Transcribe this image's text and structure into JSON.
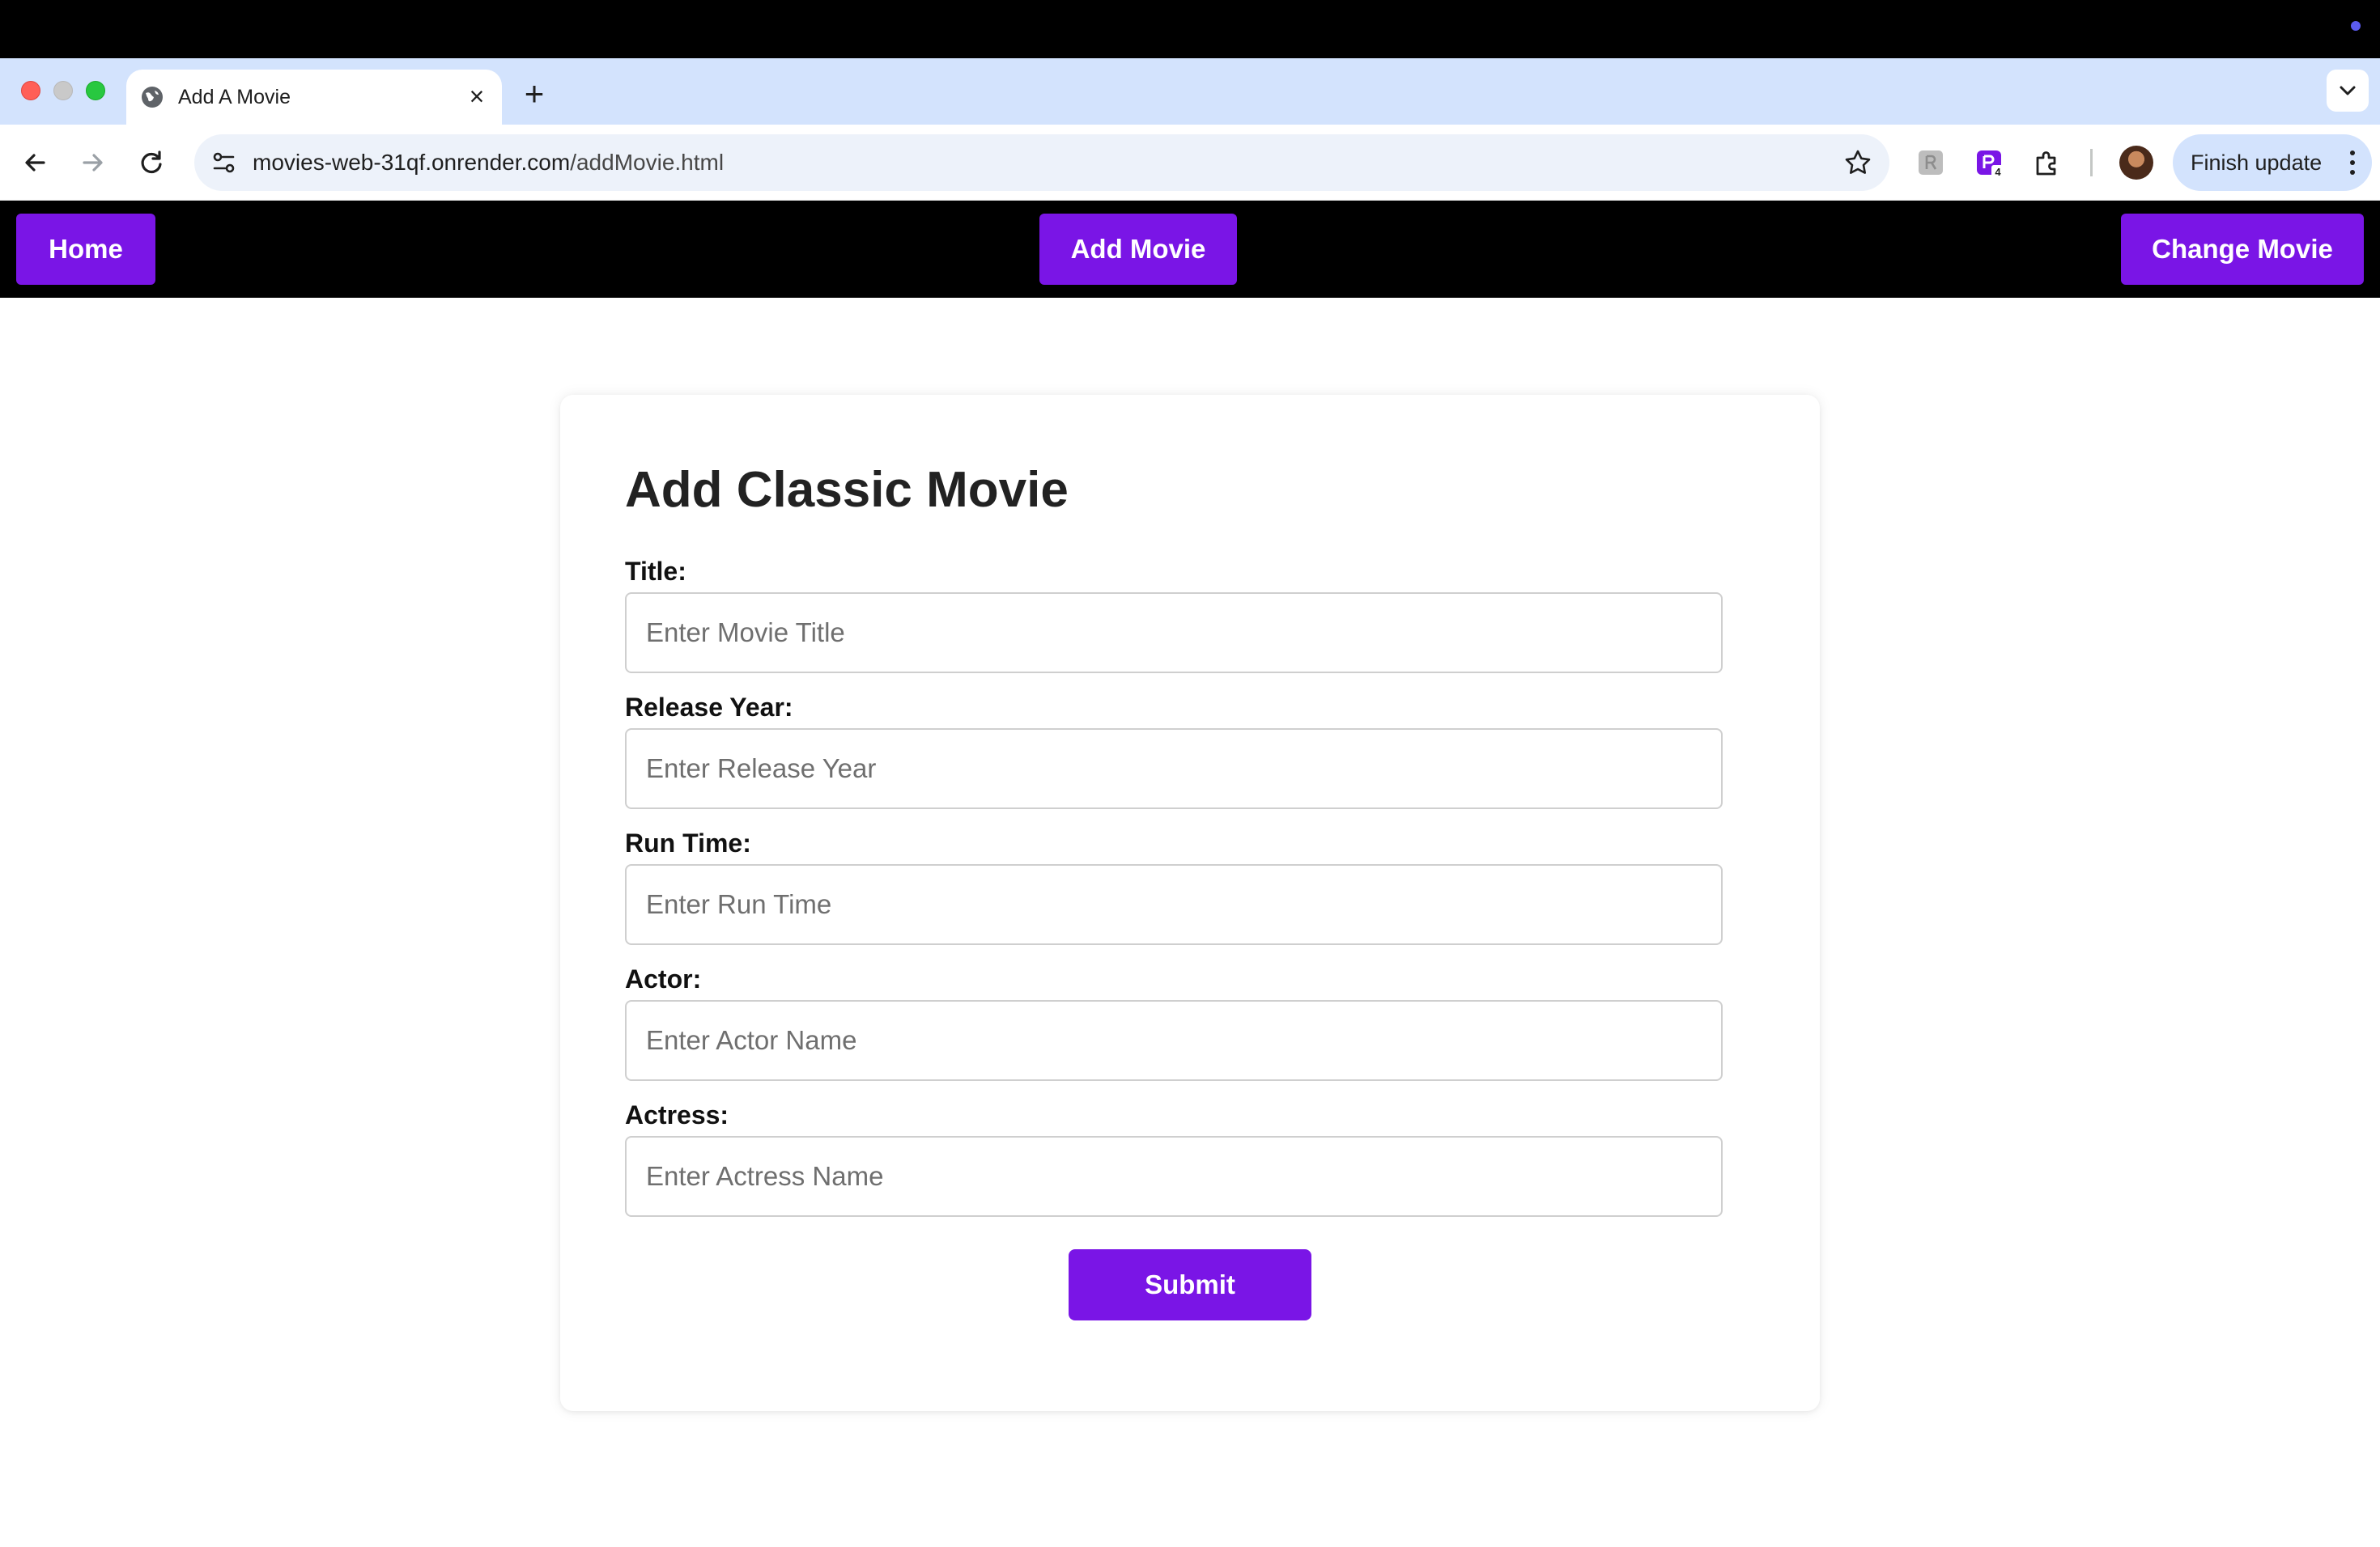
{
  "browser": {
    "tab": {
      "title": "Add A Movie",
      "icon": "globe-icon"
    },
    "url": {
      "host": "movies-web-31qf.onrender.com",
      "path": "/addMovie.html"
    },
    "finish_update_label": "Finish update",
    "extension_badge": "4"
  },
  "nav": {
    "home": "Home",
    "add_movie": "Add Movie",
    "change_movie": "Change Movie"
  },
  "form": {
    "heading": "Add Classic Movie",
    "fields": [
      {
        "label": "Title:",
        "placeholder": "Enter Movie Title"
      },
      {
        "label": "Release Year:",
        "placeholder": "Enter Release Year"
      },
      {
        "label": "Run Time:",
        "placeholder": "Enter Run Time"
      },
      {
        "label": "Actor:",
        "placeholder": "Enter Actor Name"
      },
      {
        "label": "Actress:",
        "placeholder": "Enter Actress Name"
      }
    ],
    "submit": "Submit"
  },
  "colors": {
    "accent": "#7a15e6",
    "nav_bar": "#000000",
    "tab_strip": "#d3e3fd"
  }
}
